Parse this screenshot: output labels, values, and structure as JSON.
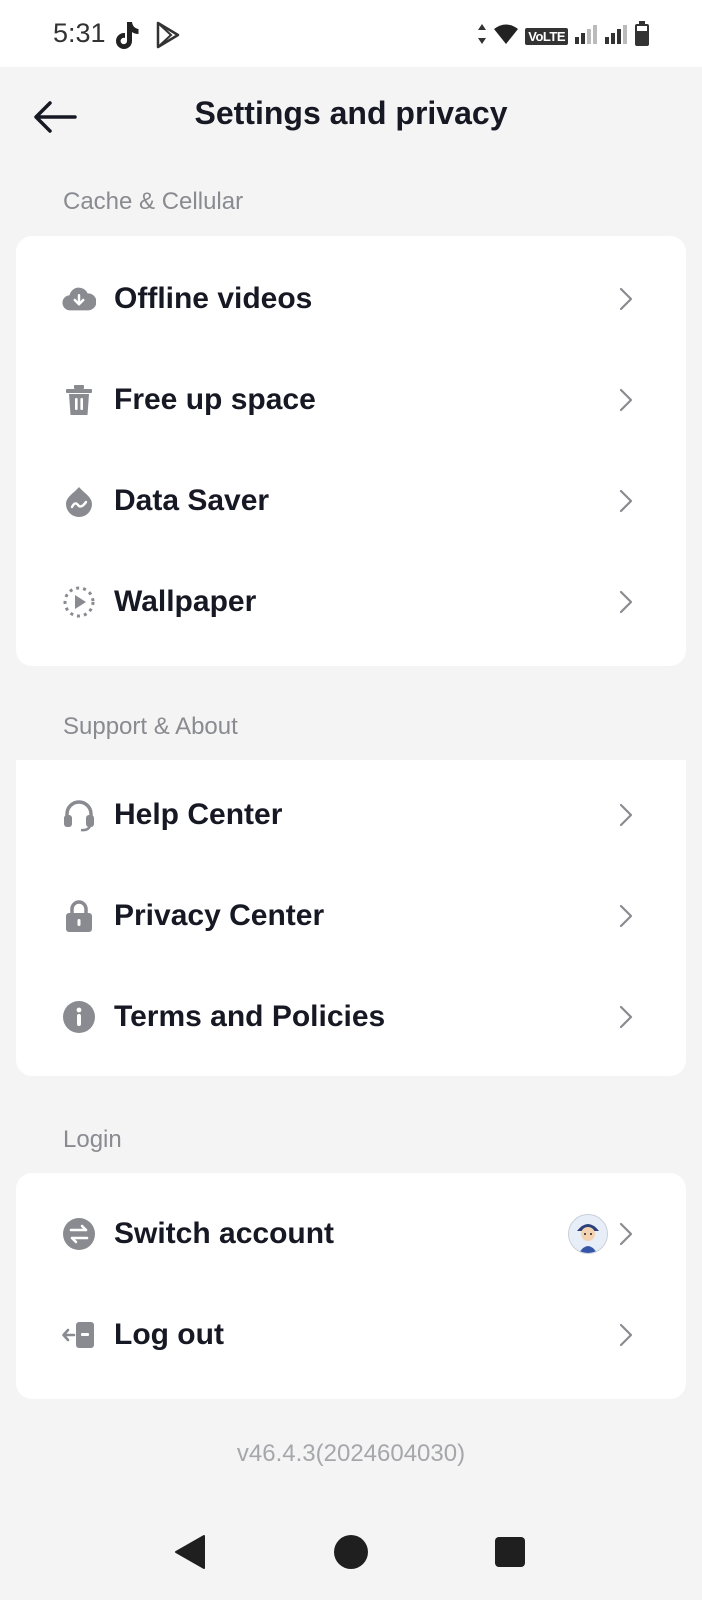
{
  "status_bar": {
    "time": "5:31",
    "network_badge": "VoLTE",
    "app_icons": [
      "tiktok-icon",
      "play-store-icon"
    ],
    "status_icons": [
      "data-arrows-icon",
      "wifi-icon",
      "signal-icon",
      "signal-icon",
      "battery-icon"
    ]
  },
  "header": {
    "title": "Settings and privacy",
    "back_icon": "arrow-left-icon"
  },
  "sections": [
    {
      "label": "Cache & Cellular",
      "items": [
        {
          "label": "Offline videos",
          "icon": "cloud-download-icon"
        },
        {
          "label": "Free up space",
          "icon": "trash-icon"
        },
        {
          "label": "Data Saver",
          "icon": "data-saver-icon"
        },
        {
          "label": "Wallpaper",
          "icon": "wallpaper-icon"
        }
      ]
    },
    {
      "label": "Support & About",
      "items": [
        {
          "label": "Help Center",
          "icon": "headset-icon"
        },
        {
          "label": "Privacy Center",
          "icon": "lock-icon"
        },
        {
          "label": "Terms and Policies",
          "icon": "info-icon"
        }
      ]
    },
    {
      "label": "Login",
      "items": [
        {
          "label": "Switch account",
          "icon": "switch-icon"
        },
        {
          "label": "Log out",
          "icon": "logout-icon"
        }
      ]
    }
  ],
  "version": "v46.4.3(2024604030)",
  "nav_bar": {
    "back_icon": "triangle-back-icon",
    "home_icon": "circle-home-icon",
    "recents_icon": "square-recents-icon"
  },
  "colors": {
    "background": "#f4f4f4",
    "card": "#ffffff",
    "text_primary": "#161823",
    "text_secondary": "#8a8b91",
    "icon_gray": "#8a8b91"
  }
}
